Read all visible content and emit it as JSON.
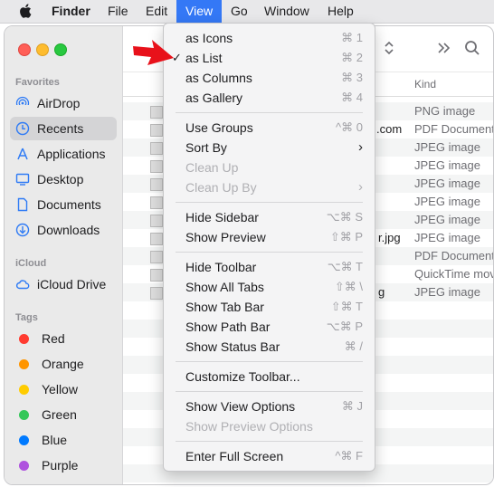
{
  "menubar": {
    "app_name": "Finder",
    "items": [
      "File",
      "Edit",
      "View",
      "Go",
      "Window",
      "Help"
    ]
  },
  "sidebar": {
    "favorites_title": "Favorites",
    "favorites": [
      {
        "label": "AirDrop",
        "icon": "airdrop-icon"
      },
      {
        "label": "Recents",
        "icon": "clock-icon",
        "selected": true
      },
      {
        "label": "Applications",
        "icon": "applications-icon"
      },
      {
        "label": "Desktop",
        "icon": "desktop-icon"
      },
      {
        "label": "Documents",
        "icon": "document-icon"
      },
      {
        "label": "Downloads",
        "icon": "download-icon"
      }
    ],
    "icloud_title": "iCloud",
    "icloud": [
      {
        "label": "iCloud Drive",
        "icon": "cloud-icon"
      }
    ],
    "tags_title": "Tags",
    "tags": [
      {
        "label": "Red",
        "color": "#ff3b30"
      },
      {
        "label": "Orange",
        "color": "#ff9500"
      },
      {
        "label": "Yellow",
        "color": "#ffcc00"
      },
      {
        "label": "Green",
        "color": "#34c759"
      },
      {
        "label": "Blue",
        "color": "#007aff"
      },
      {
        "label": "Purple",
        "color": "#af52de"
      }
    ]
  },
  "list": {
    "kind_header": "Kind",
    "name_fragments": [
      ".com",
      "r.jpg",
      "g"
    ],
    "kinds": [
      "PNG image",
      "PDF Document",
      "JPEG image",
      "JPEG image",
      "JPEG image",
      "JPEG image",
      "JPEG image",
      "JPEG image",
      "PDF Document",
      "QuickTime movie",
      "JPEG image"
    ]
  },
  "view_menu": {
    "groups": [
      [
        {
          "label": "as Icons",
          "shortcut": "⌘ 1"
        },
        {
          "label": "as List",
          "shortcut": "⌘ 2",
          "checked": true
        },
        {
          "label": "as Columns",
          "shortcut": "⌘ 3"
        },
        {
          "label": "as Gallery",
          "shortcut": "⌘ 4"
        }
      ],
      [
        {
          "label": "Use Groups",
          "shortcut": "^⌘ 0"
        },
        {
          "label": "Sort By",
          "submenu": true
        },
        {
          "label": "Clean Up",
          "disabled": true
        },
        {
          "label": "Clean Up By",
          "disabled": true,
          "submenu": true
        }
      ],
      [
        {
          "label": "Hide Sidebar",
          "shortcut": "⌥⌘ S"
        },
        {
          "label": "Show Preview",
          "shortcut": "⇧⌘ P"
        }
      ],
      [
        {
          "label": "Hide Toolbar",
          "shortcut": "⌥⌘ T"
        },
        {
          "label": "Show All Tabs",
          "shortcut": "⇧⌘ \\"
        },
        {
          "label": "Show Tab Bar",
          "shortcut": "⇧⌘ T"
        },
        {
          "label": "Show Path Bar",
          "shortcut": "⌥⌘ P"
        },
        {
          "label": "Show Status Bar",
          "shortcut": "⌘ /"
        }
      ],
      [
        {
          "label": "Customize Toolbar..."
        }
      ],
      [
        {
          "label": "Show View Options",
          "shortcut": "⌘ J"
        },
        {
          "label": "Show Preview Options",
          "disabled": true
        }
      ],
      [
        {
          "label": "Enter Full Screen",
          "shortcut": "^⌘ F"
        }
      ]
    ]
  },
  "colors": {
    "menu_highlight": "#3478f6",
    "annotation_arrow": "#e8111a"
  }
}
